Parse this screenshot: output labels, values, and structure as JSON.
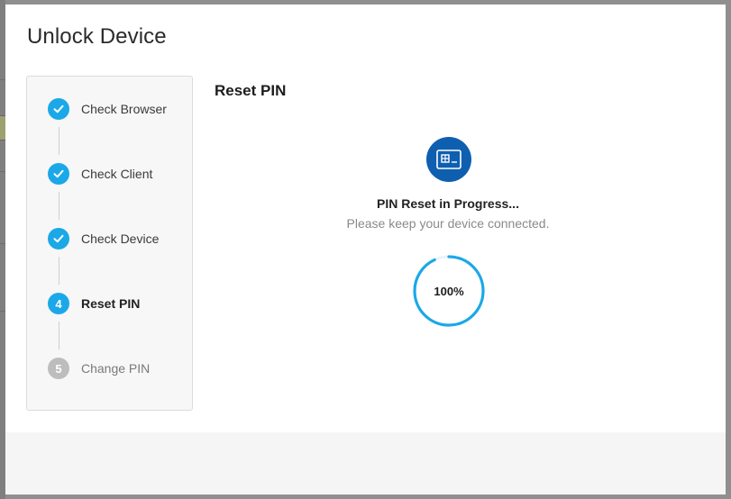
{
  "dialog": {
    "title": "Unlock Device"
  },
  "steps": [
    {
      "number": "1",
      "label": "Check Browser",
      "state": "done"
    },
    {
      "number": "2",
      "label": "Check Client",
      "state": "done"
    },
    {
      "number": "3",
      "label": "Check Device",
      "state": "done"
    },
    {
      "number": "4",
      "label": "Reset PIN",
      "state": "active"
    },
    {
      "number": "5",
      "label": "Change PIN",
      "state": "pending"
    }
  ],
  "content": {
    "section_title": "Reset PIN",
    "status_icon": "smart-card-icon",
    "status_title": "PIN Reset in Progress...",
    "status_subtitle": "Please keep your device connected.",
    "progress_percent": 100,
    "progress_label": "100%"
  },
  "colors": {
    "accent": "#1ba8e8",
    "icon_badge": "#0f5fb0",
    "pending_step": "#bdbdbd"
  }
}
